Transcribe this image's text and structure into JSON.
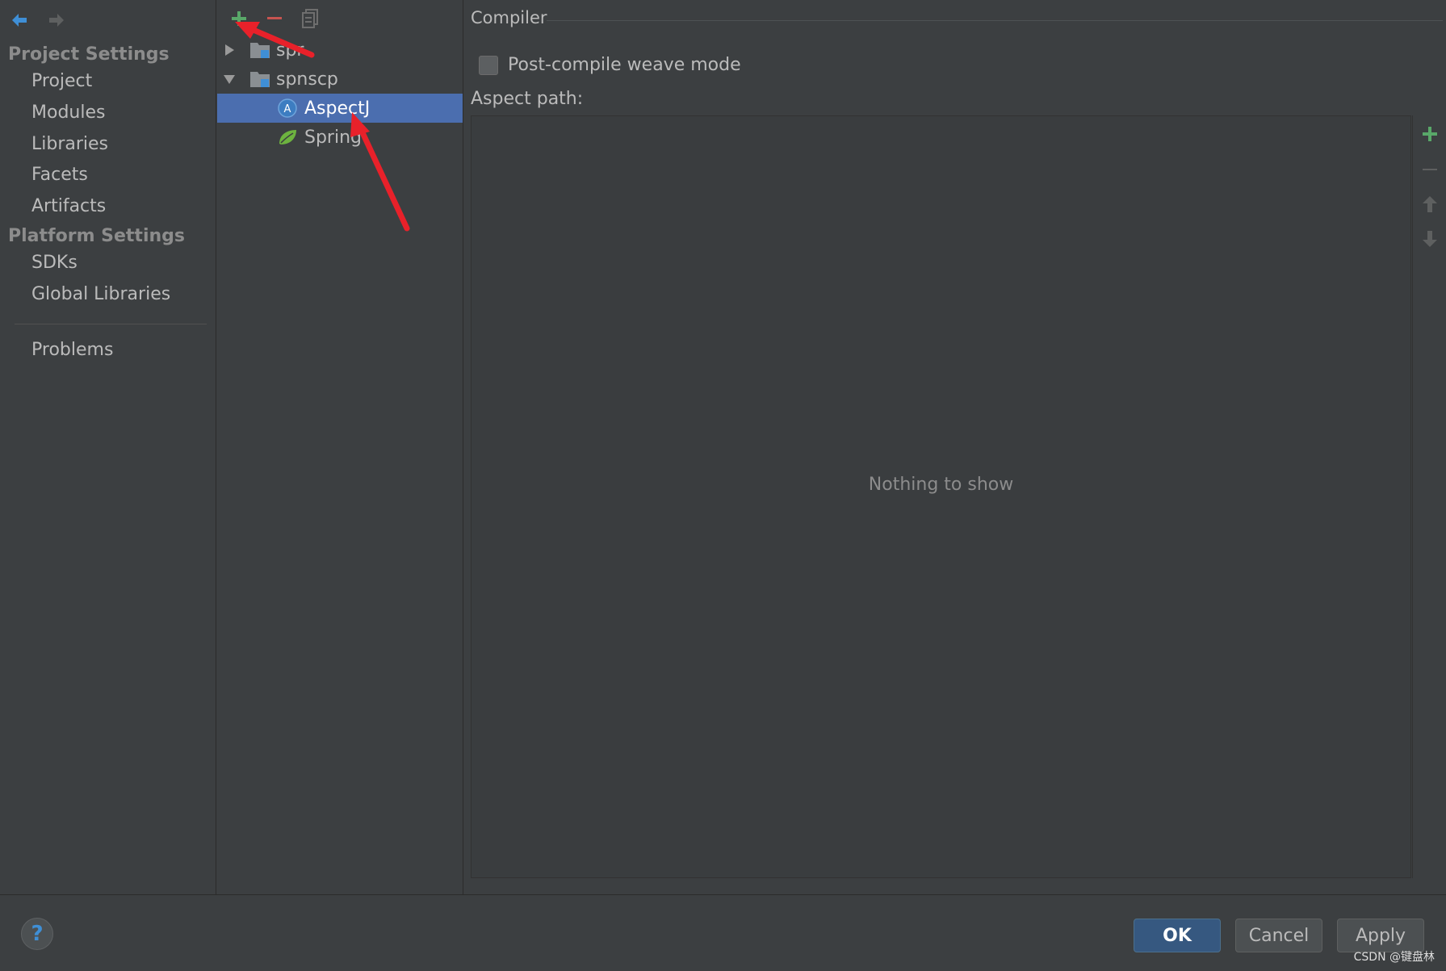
{
  "sidebar": {
    "project_settings_header": "Project Settings",
    "project_items": [
      "Project",
      "Modules",
      "Libraries",
      "Facets",
      "Artifacts"
    ],
    "platform_settings_header": "Platform Settings",
    "platform_items": [
      "SDKs",
      "Global Libraries"
    ],
    "problems_label": "Problems",
    "icons": [
      "back-arrow-icon",
      "forward-arrow-icon"
    ]
  },
  "tree": {
    "toolbar_icons": [
      "add-icon",
      "remove-icon",
      "copy-icon"
    ],
    "nodes": [
      {
        "label": "spr",
        "type": "module",
        "expanded": false
      },
      {
        "label": "spnscp",
        "type": "module",
        "expanded": true
      },
      {
        "label": "AspectJ",
        "type": "facet",
        "selected": true,
        "icon": "aspectj-icon"
      },
      {
        "label": "Spring",
        "type": "facet",
        "selected": false,
        "icon": "spring-leaf-icon"
      }
    ]
  },
  "compiler": {
    "title": "Compiler",
    "post_compile_label": "Post-compile weave mode",
    "post_compile_checked": false,
    "aspect_path_label": "Aspect path:",
    "empty_text": "Nothing to show",
    "list_toolbar_icons": [
      "add-icon",
      "remove-icon",
      "move-up-icon",
      "move-down-icon"
    ]
  },
  "footer": {
    "help_label": "?",
    "ok_label": "OK",
    "cancel_label": "Cancel",
    "apply_label": "Apply"
  },
  "watermark": "CSDN @键盘林",
  "colors": {
    "background": "#3c3f41",
    "selection": "#4b6eaf",
    "add_green": "#59a869",
    "remove_red": "#c75450",
    "link_blue": "#3f8fd6",
    "ok_button": "#365880",
    "annotation_arrow": "#e8212a"
  }
}
